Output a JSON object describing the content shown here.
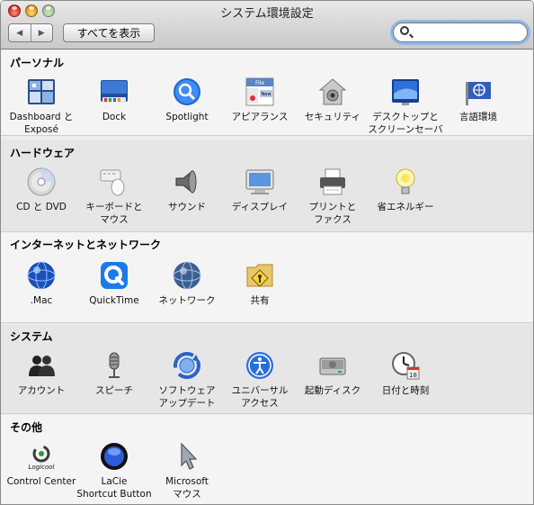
{
  "window": {
    "title": "システム環境設定"
  },
  "toolbar": {
    "back_label": "◀",
    "forward_label": "▶",
    "show_all_label": "すべてを表示",
    "search_placeholder": ""
  },
  "sections": [
    {
      "title": "パーソナル",
      "items": [
        {
          "label": "Dashboard と\nExposé",
          "icon": "dashboard-expose-icon"
        },
        {
          "label": "Dock",
          "icon": "dock-icon"
        },
        {
          "label": "Spotlight",
          "icon": "spotlight-icon"
        },
        {
          "label": "アピアランス",
          "icon": "appearance-icon"
        },
        {
          "label": "セキュリティ",
          "icon": "security-house-icon"
        },
        {
          "label": "デスクトップと\nスクリーンセーバ",
          "icon": "desktop-screensaver-icon"
        },
        {
          "label": "言語環境",
          "icon": "international-flag-icon"
        }
      ]
    },
    {
      "title": "ハードウェア",
      "items": [
        {
          "label": "CD と DVD",
          "icon": "cd-dvd-icon"
        },
        {
          "label": "キーボードと\nマウス",
          "icon": "keyboard-mouse-icon"
        },
        {
          "label": "サウンド",
          "icon": "speaker-icon"
        },
        {
          "label": "ディスプレイ",
          "icon": "display-icon"
        },
        {
          "label": "プリントと\nファクス",
          "icon": "printer-icon"
        },
        {
          "label": "省エネルギー",
          "icon": "lightbulb-icon"
        }
      ]
    },
    {
      "title": "インターネットとネットワーク",
      "items": [
        {
          "label": ".Mac",
          "icon": "dotmac-globe-icon"
        },
        {
          "label": "QuickTime",
          "icon": "quicktime-icon"
        },
        {
          "label": "ネットワーク",
          "icon": "network-globe-icon"
        },
        {
          "label": "共有",
          "icon": "sharing-folder-icon"
        }
      ]
    },
    {
      "title": "システム",
      "items": [
        {
          "label": "アカウント",
          "icon": "accounts-icon"
        },
        {
          "label": "スピーチ",
          "icon": "microphone-icon"
        },
        {
          "label": "ソフトウェア\nアップデート",
          "icon": "software-update-icon"
        },
        {
          "label": "ユニバーサル\nアクセス",
          "icon": "universal-access-icon"
        },
        {
          "label": "起動ディスク",
          "icon": "startup-disk-icon"
        },
        {
          "label": "日付と時刻",
          "icon": "date-time-clock-icon"
        }
      ]
    },
    {
      "title": "その他",
      "items": [
        {
          "label": "Control Center",
          "icon": "logicool-icon"
        },
        {
          "label": "LaCie\nShortcut Button",
          "icon": "lacie-button-icon"
        },
        {
          "label": "Microsoft\nマウス",
          "icon": "microsoft-mouse-icon"
        }
      ],
      "logo_text": "Logicool"
    }
  ]
}
